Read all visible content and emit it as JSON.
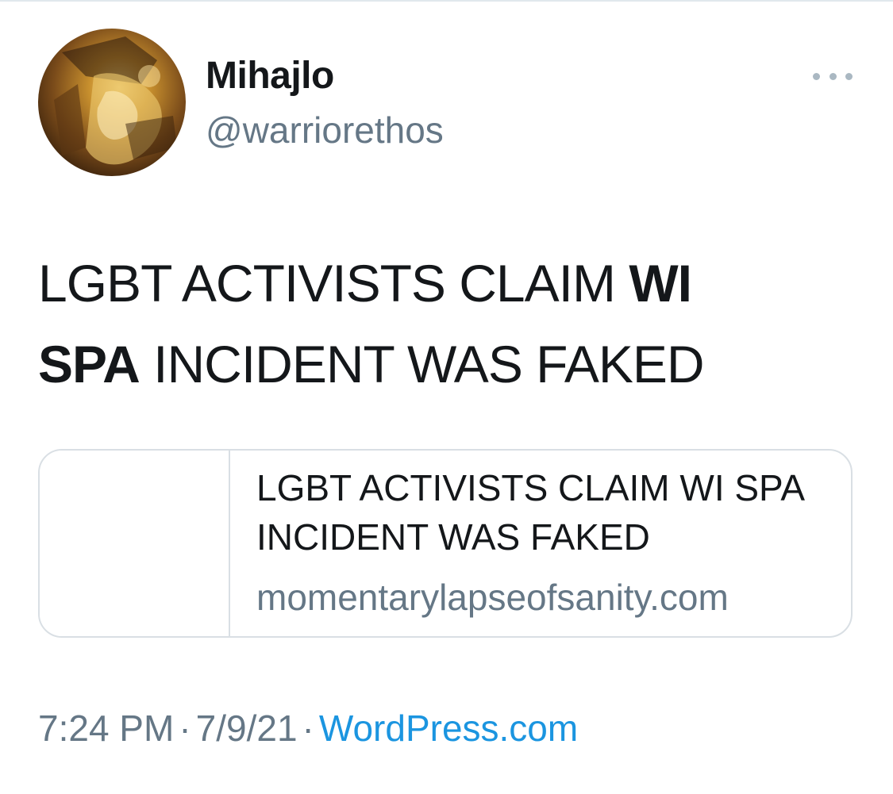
{
  "user": {
    "display_name": "Mihajlo",
    "handle": "@warriorethos"
  },
  "tweet": {
    "text_part1": "LGBT ACTIVISTS CLAIM ",
    "text_bold1": "WI",
    "text_bold2": "SPA",
    "text_part2": " INCIDENT WAS FAKED"
  },
  "link_card": {
    "title": "LGBT ACTIVISTS CLAIM WI SPA INCIDENT WAS FAKED",
    "domain": "momentarylapseofsanity.com"
  },
  "meta": {
    "time": "7:24 PM",
    "separator": "·",
    "date": "7/9/21",
    "source": "WordPress.com"
  },
  "colors": {
    "text_primary": "#14171a",
    "text_secondary": "#657786",
    "link": "#1b95e0",
    "border": "#d9dfe4"
  },
  "icons": {
    "more": "more-options-icon"
  }
}
